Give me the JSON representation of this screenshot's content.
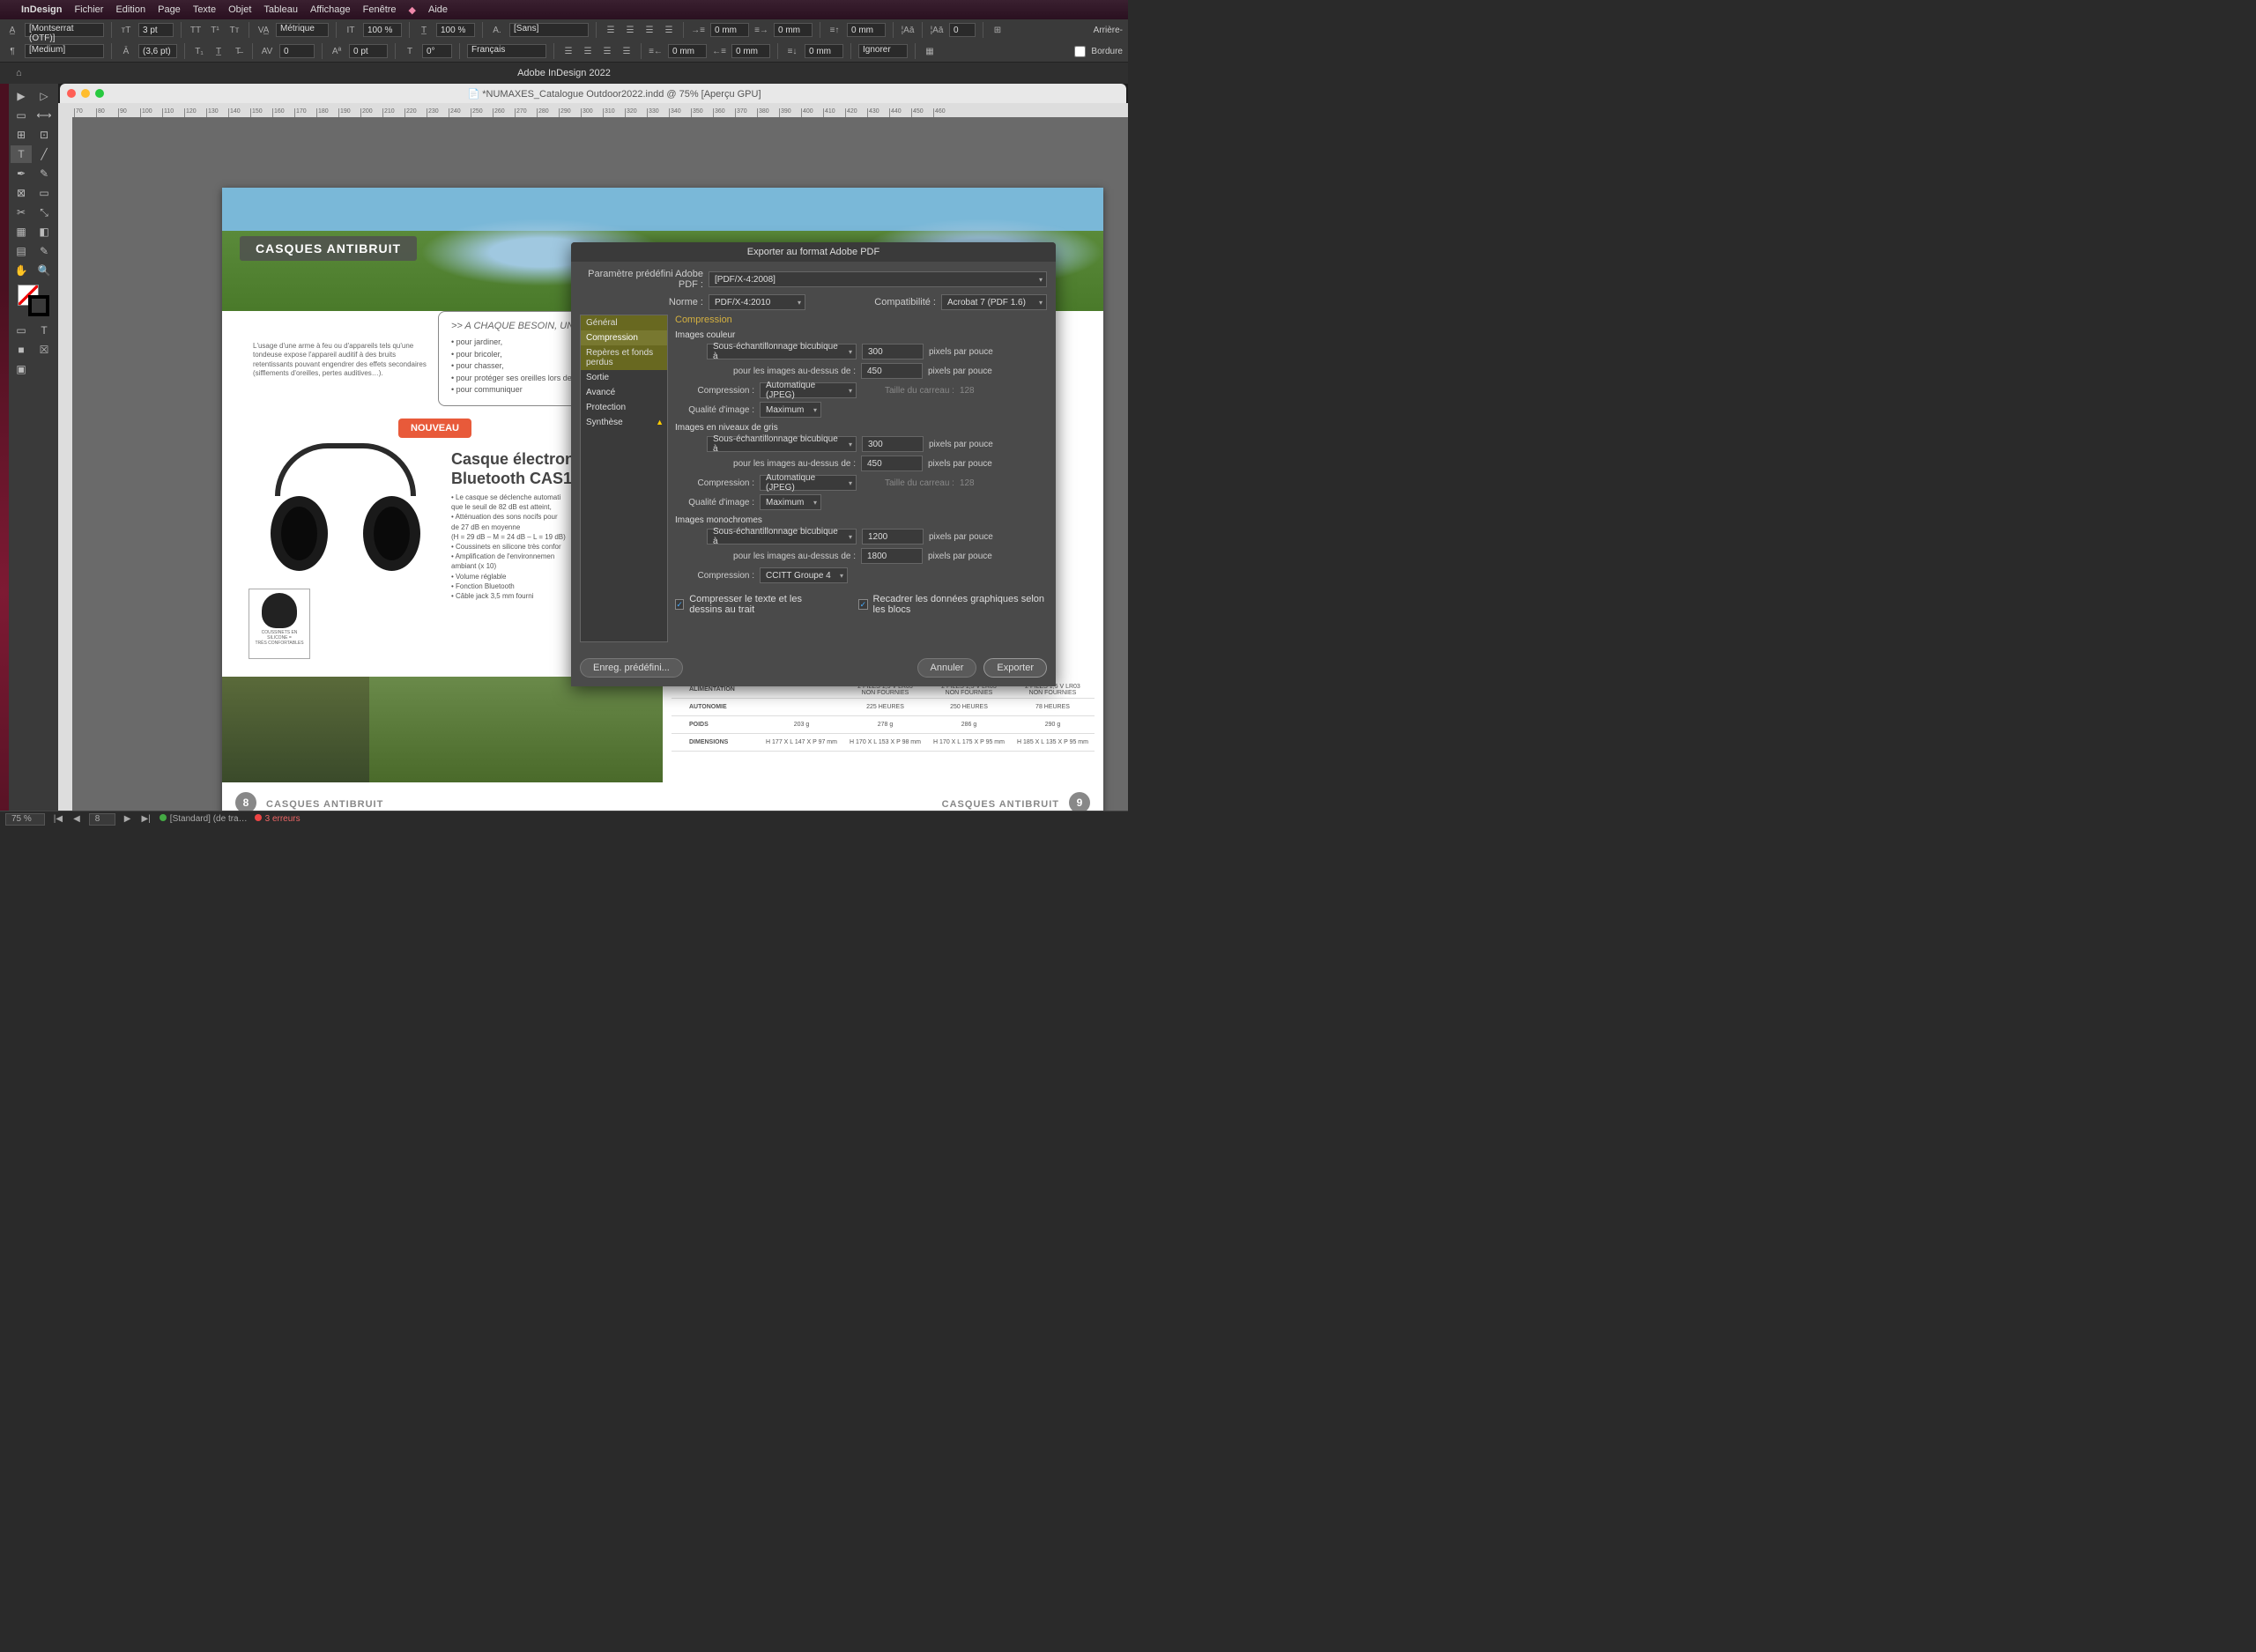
{
  "menubar": {
    "app": "InDesign",
    "items": [
      "Fichier",
      "Edition",
      "Page",
      "Texte",
      "Objet",
      "Tableau",
      "Affichage",
      "Fenêtre",
      "Aide"
    ]
  },
  "controlbar": {
    "font": "[Montserrat (OTF)]",
    "style": "[Medium]",
    "size": "3 pt",
    "leading": "(3,6 pt)",
    "metrics": "Métrique",
    "scale_h": "100 %",
    "scale_v": "100 %",
    "char_style": "[Sans]",
    "fill_label": "[Sans]",
    "space_before": "0 mm",
    "space_after": "0 mm",
    "indent_left": "0 mm",
    "indent_right": "0 mm",
    "indent_first": "0 mm",
    "ignore": "Ignorer",
    "drop_cap": "0",
    "lang": "Français",
    "reverse": "Arrière-",
    "border": "Bordure",
    "tracking": "0"
  },
  "apptitle": "Adobe InDesign 2022",
  "doc": {
    "title": "*NUMAXES_Catalogue Outdoor2022.indd @ 75% [Aperçu GPU]"
  },
  "page_left": {
    "hero_title": "CASQUES ANTIBRUIT",
    "tagline": ">> A CHAQUE BESOIN, UN",
    "intro_text": "L'usage d'une arme à feu ou d'appareils tels qu'une tondeuse expose l'appareil auditif à des bruits retentissants pouvant engendrer des effets secondaires (sifflements d'oreilles, pertes auditives…).",
    "uses": [
      "• pour jardiner,",
      "• pour bricoler,",
      "• pour chasser,",
      "• pour protéger ses oreilles lors de ti",
      "• pour communiquer"
    ],
    "nouveau": "NOUVEAU",
    "prod_title1": "Casque électron",
    "prod_title2": "Bluetooth CAS1",
    "bullets": [
      "• Le casque se déclenche automati",
      "  que le seuil de 82 dB est atteint,",
      "• Atténuation des sons nocifs pour",
      "  de 27 dB en moyenne",
      "  (H = 29 dB – M = 24 dB – L = 19 dB)",
      "• Coussinets en silicone très confor",
      "• Amplification de l'environnemen",
      "  ambiant (x 10)",
      "• Volume réglable",
      "• Fonction Bluetooth",
      "• Câble jack 3,5 mm fourni"
    ],
    "thumb_caption": "COUSSINETS EN\nSILICONE =\nTRÈS CONFORTABLES",
    "pagenum": "8",
    "footer": "CASQUES ANTIBRUIT"
  },
  "page_right": {
    "table_rows": [
      {
        "label": "ALIMENTATION",
        "cells": [
          "",
          "2 PILES 1,5 V LR03\nNON FOURNIES",
          "2 PILES 1,5 V LR03\nNON FOURNIES",
          "2 PILES 1,5 V LR03\nNON FOURNIES"
        ]
      },
      {
        "label": "AUTONOMIE",
        "cells": [
          "",
          "225 HEURES",
          "250 HEURES",
          "78 HEURES"
        ]
      },
      {
        "label": "POIDS",
        "cells": [
          "203 g",
          "278 g",
          "286 g",
          "290 g"
        ]
      },
      {
        "label": "DIMENSIONS",
        "cells": [
          "H 177 X L 147 X P 97 mm",
          "H 170 X L 153 X P 98 mm",
          "H 170 X L 175 X P 95 mm",
          "H 185 X L 135 X P 95 mm"
        ]
      }
    ],
    "pagenum": "9",
    "footer": "CASQUES ANTIBRUIT"
  },
  "dialog": {
    "title": "Exporter au format Adobe PDF",
    "preset_label": "Paramètre prédéfini Adobe PDF :",
    "preset_value": "[PDF/X-4:2008]",
    "norme_label": "Norme :",
    "norme_value": "PDF/X-4:2010",
    "compat_label": "Compatibilité :",
    "compat_value": "Acrobat 7 (PDF 1.6)",
    "tabs": [
      "Général",
      "Compression",
      "Repères et fonds perdus",
      "Sortie",
      "Avancé",
      "Protection",
      "Synthèse"
    ],
    "panel_title": "Compression",
    "sections": {
      "color": {
        "title": "Images couleur",
        "method": "Sous-échantillonnage bicubique à",
        "dpi": "300",
        "above_label": "pour les images au-dessus de :",
        "above": "450",
        "compression_label": "Compression :",
        "compression": "Automatique (JPEG)",
        "tile_label": "Taille du carreau :",
        "tile": "128",
        "quality_label": "Qualité d'image :",
        "quality": "Maximum"
      },
      "gray": {
        "title": "Images en niveaux de gris",
        "method": "Sous-échantillonnage bicubique à",
        "dpi": "300",
        "above_label": "pour les images au-dessus de :",
        "above": "450",
        "compression_label": "Compression :",
        "compression": "Automatique (JPEG)",
        "tile_label": "Taille du carreau :",
        "tile": "128",
        "quality_label": "Qualité d'image :",
        "quality": "Maximum"
      },
      "mono": {
        "title": "Images monochromes",
        "method": "Sous-échantillonnage bicubique à",
        "dpi": "1200",
        "above_label": "pour les images au-dessus de :",
        "above": "1800",
        "compression_label": "Compression :",
        "compression": "CCITT Groupe 4"
      }
    },
    "unit": "pixels par pouce",
    "chk1": "Compresser le texte et les dessins au trait",
    "chk2": "Recadrer les données graphiques selon les blocs",
    "btn_save_preset": "Enreg. prédéfini...",
    "btn_cancel": "Annuler",
    "btn_export": "Exporter"
  },
  "statusbar": {
    "zoom": "75 %",
    "page": "8",
    "preflight": "[Standard] (de tra…",
    "errors": "3 erreurs"
  }
}
